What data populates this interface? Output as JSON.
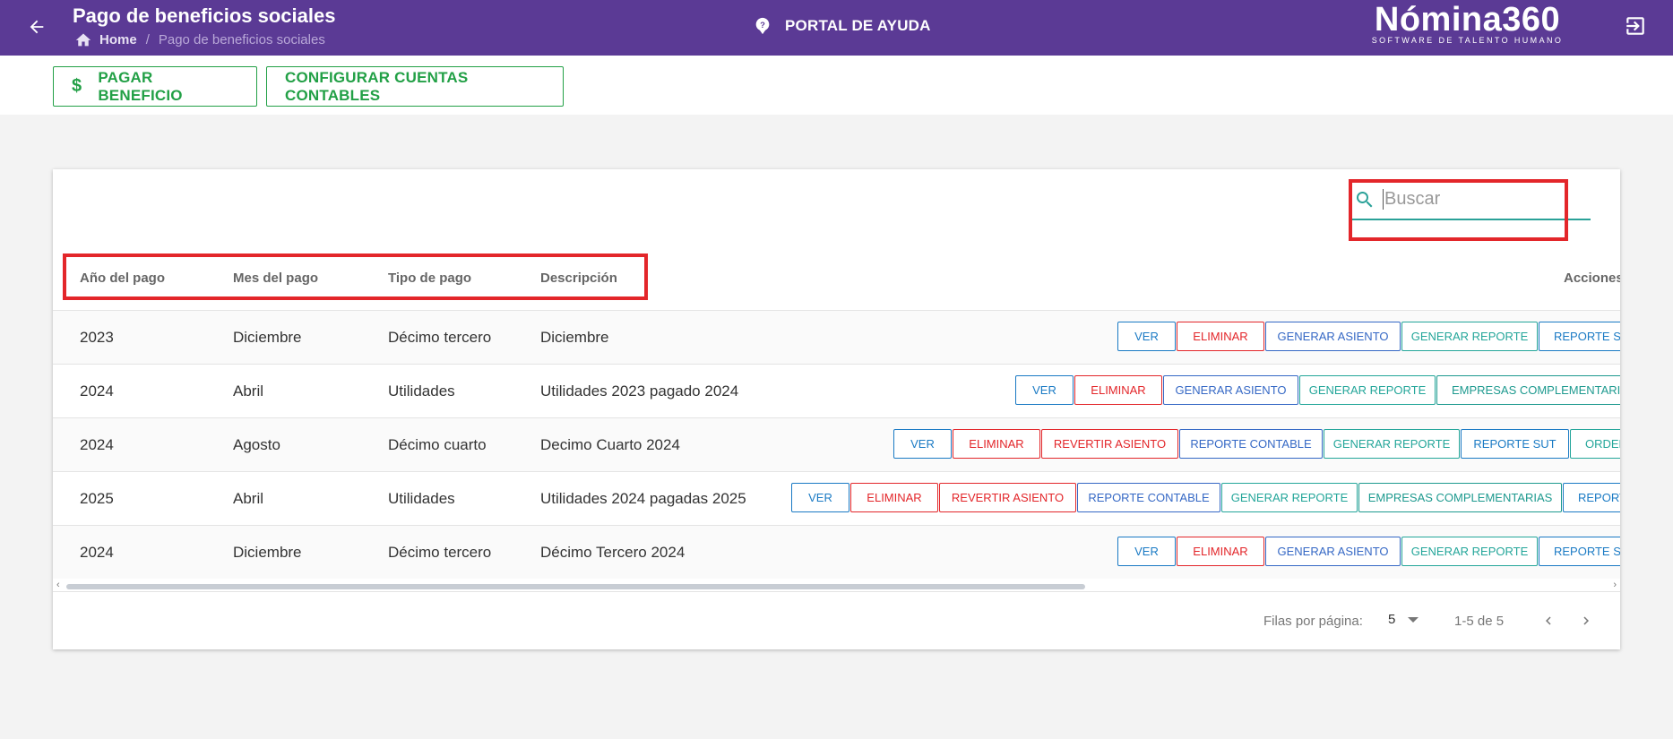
{
  "header": {
    "title": "Pago de beneficios sociales",
    "breadcrumb": {
      "home": "Home",
      "separator": "/",
      "current": "Pago de beneficios sociales"
    },
    "help_label": "PORTAL DE AYUDA",
    "logo_main": "Nómina360",
    "logo_sub": "SOFTWARE DE TALENTO HUMANO",
    "background_color": "#5b3a95"
  },
  "toolbar": {
    "pay_icon": "$",
    "pay_label": "PAGAR BENEFICIO",
    "config_label": "CONFIGURAR CUENTAS CONTABLES",
    "accent_color": "#22a046"
  },
  "search": {
    "placeholder": "Buscar"
  },
  "table": {
    "columns": [
      "Año del pago",
      "Mes del pago",
      "Tipo de pago",
      "Descripción"
    ],
    "actions_header": "Acciones",
    "rows": [
      {
        "year": "2023",
        "month": "Diciembre",
        "type": "Décimo tercero",
        "description": "Diciembre",
        "actions": [
          "VER",
          "ELIMINAR",
          "GENERAR ASIENTO",
          "GENERAR REPORTE",
          "REPORTE SU"
        ]
      },
      {
        "year": "2024",
        "month": "Abril",
        "type": "Utilidades",
        "description": "Utilidades 2023 pagado 2024",
        "actions": [
          "VER",
          "ELIMINAR",
          "GENERAR ASIENTO",
          "GENERAR REPORTE",
          "EMPRESAS COMPLEMENTARIAS"
        ]
      },
      {
        "year": "2024",
        "month": "Agosto",
        "type": "Décimo cuarto",
        "description": "Decimo Cuarto 2024",
        "actions": [
          "VER",
          "ELIMINAR",
          "REVERTIR ASIENTO",
          "REPORTE CONTABLE",
          "GENERAR REPORTE",
          "REPORTE SUT",
          "ORDEN"
        ]
      },
      {
        "year": "2025",
        "month": "Abril",
        "type": "Utilidades",
        "description": "Utilidades 2024 pagadas 2025",
        "actions": [
          "VER",
          "ELIMINAR",
          "REVERTIR ASIENTO",
          "REPORTE CONTABLE",
          "GENERAR REPORTE",
          "EMPRESAS COMPLEMENTARIAS",
          "REPORT"
        ]
      },
      {
        "year": "2024",
        "month": "Diciembre",
        "type": "Décimo tercero",
        "description": "Décimo Tercero 2024",
        "actions": [
          "VER",
          "ELIMINAR",
          "GENERAR ASIENTO",
          "GENERAR REPORTE",
          "REPORTE SU"
        ]
      }
    ]
  },
  "pagination": {
    "rows_per_page_label": "Filas por página:",
    "rows_per_page": "5",
    "range": "1-5 de 5"
  },
  "icons": [
    "back-arrow-icon",
    "home-icon",
    "help-icon",
    "logout-icon",
    "dollar-icon",
    "search-icon",
    "chevron-left-icon",
    "chevron-right-icon"
  ]
}
